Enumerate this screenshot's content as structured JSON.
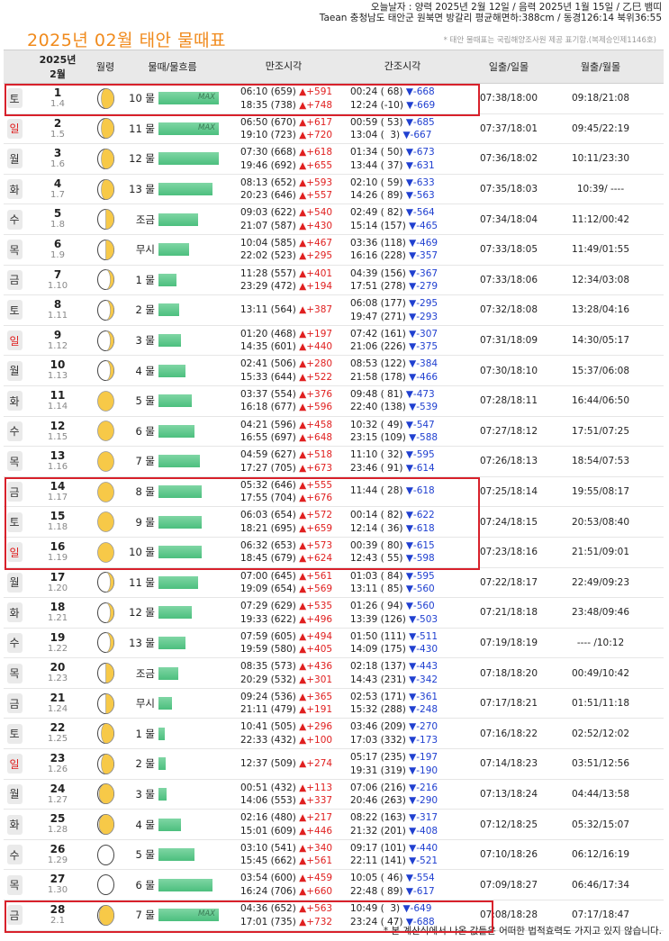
{
  "header": {
    "line1": "오늘날자 : 양력 2025년 2월 12일 / 음력 2025년 1월 15일 / 乙巳 뱀띠",
    "line2": "Taean 충청남도 태안군 원북면 방갈리 평균해면하:388cm / 동경126:14 북위36:55",
    "title": "2025년 02월 태안 물때표",
    "source": "* 태안 물때표는 국립해양조사원 제공 표기함.(복제승인제1146호)"
  },
  "columns": {
    "date_year": "2025년",
    "date_month": "2월",
    "moon": "월령",
    "tide": "물때/물흐름",
    "high": "만조시각",
    "low": "간조시각",
    "sun": "일출/일몰",
    "moonrise": "월출/월몰"
  },
  "colors": {
    "accent": "#f08a1c",
    "rise": "#e02020",
    "fall": "#2040d0",
    "bar": "#4cbf7e",
    "highlight": "#d8212b",
    "moon": "#f7c948"
  },
  "rows": [
    {
      "wd": "토",
      "sun": false,
      "d": "1",
      "l": "1.4",
      "moon": "crescent",
      "tide": "10 물",
      "bar": 1.0,
      "max": "MAX",
      "high": [
        "06:10 (659) ▲+591",
        "18:35 (738) ▲+748"
      ],
      "low": [
        "00:24 ( 68) ▼-668",
        "12:24 (-10) ▼-669"
      ],
      "ss": "07:38/18:00",
      "mr": "09:18/21:08"
    },
    {
      "wd": "일",
      "sun": true,
      "d": "2",
      "l": "1.5",
      "moon": "crescent",
      "tide": "11 물",
      "bar": 1.0,
      "max": "MAX",
      "high": [
        "06:50 (670) ▲+617",
        "19:10 (723) ▲+720"
      ],
      "low": [
        "00:59 ( 53) ▼-685",
        "13:04 (  3) ▼-667"
      ],
      "ss": "07:37/18:01",
      "mr": "09:45/22:19"
    },
    {
      "wd": "월",
      "sun": false,
      "d": "3",
      "l": "1.6",
      "moon": "crescent",
      "tide": "12 물",
      "bar": 1.0,
      "max": "",
      "high": [
        "07:30 (668) ▲+618",
        "19:46 (692) ▲+655"
      ],
      "low": [
        "01:34 ( 50) ▼-673",
        "13:44 ( 37) ▼-631"
      ],
      "ss": "07:36/18:02",
      "mr": "10:11/23:30"
    },
    {
      "wd": "화",
      "sun": false,
      "d": "4",
      "l": "1.7",
      "moon": "crescent",
      "tide": "13 물",
      "bar": 0.9,
      "max": "",
      "high": [
        "08:13 (652) ▲+593",
        "20:23 (646) ▲+557"
      ],
      "low": [
        "02:10 ( 59) ▼-633",
        "14:26 ( 89) ▼-563"
      ],
      "ss": "07:35/18:03",
      "mr": "10:39/ ----"
    },
    {
      "wd": "수",
      "sun": false,
      "d": "5",
      "l": "1.8",
      "moon": "half",
      "tide": "조금",
      "bar": 0.66,
      "max": "",
      "high": [
        "09:03 (622) ▲+540",
        "21:07 (587) ▲+430"
      ],
      "low": [
        "02:49 ( 82) ▼-564",
        "15:14 (157) ▼-465"
      ],
      "ss": "07:34/18:04",
      "mr": "11:12/00:42"
    },
    {
      "wd": "목",
      "sun": false,
      "d": "6",
      "l": "1.9",
      "moon": "half",
      "tide": "무시",
      "bar": 0.5,
      "max": "",
      "high": [
        "10:04 (585) ▲+467",
        "22:02 (523) ▲+295"
      ],
      "low": [
        "03:36 (118) ▼-469",
        "16:16 (228) ▼-357"
      ],
      "ss": "07:33/18:05",
      "mr": "11:49/01:55"
    },
    {
      "wd": "금",
      "sun": false,
      "d": "7",
      "l": "1.10",
      "moon": "gibbous",
      "tide": "1 물",
      "bar": 0.3,
      "max": "",
      "high": [
        "11:28 (557) ▲+401",
        "23:29 (472) ▲+194"
      ],
      "low": [
        "04:39 (156) ▼-367",
        "17:51 (278) ▼-279"
      ],
      "ss": "07:33/18:06",
      "mr": "12:34/03:08"
    },
    {
      "wd": "토",
      "sun": false,
      "d": "8",
      "l": "1.11",
      "moon": "gibbous",
      "tide": "2 물",
      "bar": 0.35,
      "max": "",
      "high": [
        "13:11 (564) ▲+387"
      ],
      "low": [
        "06:08 (177) ▼-295",
        "19:47 (271) ▼-293"
      ],
      "ss": "07:32/18:08",
      "mr": "13:28/04:16"
    },
    {
      "wd": "일",
      "sun": true,
      "d": "9",
      "l": "1.12",
      "moon": "gibbous",
      "tide": "3 물",
      "bar": 0.38,
      "max": "",
      "high": [
        "01:20 (468) ▲+197",
        "14:35 (601) ▲+440"
      ],
      "low": [
        "07:42 (161) ▼-307",
        "21:06 (226) ▼-375"
      ],
      "ss": "07:31/18:09",
      "mr": "14:30/05:17"
    },
    {
      "wd": "월",
      "sun": false,
      "d": "10",
      "l": "1.13",
      "moon": "gibbous",
      "tide": "4 물",
      "bar": 0.45,
      "max": "",
      "high": [
        "02:41 (506) ▲+280",
        "15:33 (644) ▲+522"
      ],
      "low": [
        "08:53 (122) ▼-384",
        "21:58 (178) ▼-466"
      ],
      "ss": "07:30/18:10",
      "mr": "15:37/06:08"
    },
    {
      "wd": "화",
      "sun": false,
      "d": "11",
      "l": "1.14",
      "moon": "full",
      "tide": "5 물",
      "bar": 0.55,
      "max": "",
      "high": [
        "03:37 (554) ▲+376",
        "16:18 (677) ▲+596"
      ],
      "low": [
        "09:48 ( 81) ▼-473",
        "22:40 (138) ▼-539"
      ],
      "ss": "07:28/18:11",
      "mr": "16:44/06:50"
    },
    {
      "wd": "수",
      "sun": false,
      "d": "12",
      "l": "1.15",
      "moon": "full",
      "tide": "6 물",
      "bar": 0.6,
      "max": "",
      "high": [
        "04:21 (596) ▲+458",
        "16:55 (697) ▲+648"
      ],
      "low": [
        "10:32 ( 49) ▼-547",
        "23:15 (109) ▼-588"
      ],
      "ss": "07:27/18:12",
      "mr": "17:51/07:25"
    },
    {
      "wd": "목",
      "sun": false,
      "d": "13",
      "l": "1.16",
      "moon": "full",
      "tide": "7 물",
      "bar": 0.68,
      "max": "",
      "high": [
        "04:59 (627) ▲+518",
        "17:27 (705) ▲+673"
      ],
      "low": [
        "11:10 ( 32) ▼-595",
        "23:46 ( 91) ▼-614"
      ],
      "ss": "07:26/18:13",
      "mr": "18:54/07:53"
    },
    {
      "wd": "금",
      "sun": false,
      "d": "14",
      "l": "1.17",
      "moon": "full",
      "tide": "8 물",
      "bar": 0.72,
      "max": "",
      "high": [
        "05:32 (646) ▲+555",
        "17:55 (704) ▲+676"
      ],
      "low": [
        "11:44 ( 28) ▼-618"
      ],
      "ss": "07:25/18:14",
      "mr": "19:55/08:17"
    },
    {
      "wd": "토",
      "sun": false,
      "d": "15",
      "l": "1.18",
      "moon": "full",
      "tide": "9 물",
      "bar": 0.72,
      "max": "",
      "high": [
        "06:03 (654) ▲+572",
        "18:21 (695) ▲+659"
      ],
      "low": [
        "00:14 ( 82) ▼-622",
        "12:14 ( 36) ▼-618"
      ],
      "ss": "07:24/18:15",
      "mr": "20:53/08:40"
    },
    {
      "wd": "일",
      "sun": true,
      "d": "16",
      "l": "1.19",
      "moon": "full",
      "tide": "10 물",
      "bar": 0.72,
      "max": "",
      "high": [
        "06:32 (653) ▲+573",
        "18:45 (679) ▲+624"
      ],
      "low": [
        "00:39 ( 80) ▼-615",
        "12:43 ( 55) ▼-598"
      ],
      "ss": "07:23/18:16",
      "mr": "21:51/09:01"
    },
    {
      "wd": "월",
      "sun": false,
      "d": "17",
      "l": "1.20",
      "moon": "gibbous",
      "tide": "11 물",
      "bar": 0.65,
      "max": "",
      "high": [
        "07:00 (645) ▲+561",
        "19:09 (654) ▲+569"
      ],
      "low": [
        "01:03 ( 84) ▼-595",
        "13:11 ( 85) ▼-560"
      ],
      "ss": "07:22/18:17",
      "mr": "22:49/09:23"
    },
    {
      "wd": "화",
      "sun": false,
      "d": "18",
      "l": "1.21",
      "moon": "gibbous",
      "tide": "12 물",
      "bar": 0.55,
      "max": "",
      "high": [
        "07:29 (629) ▲+535",
        "19:33 (622) ▲+496"
      ],
      "low": [
        "01:26 ( 94) ▼-560",
        "13:39 (126) ▼-503"
      ],
      "ss": "07:21/18:18",
      "mr": "23:48/09:46"
    },
    {
      "wd": "수",
      "sun": false,
      "d": "19",
      "l": "1.22",
      "moon": "gibbous",
      "tide": "13 물",
      "bar": 0.45,
      "max": "",
      "high": [
        "07:59 (605) ▲+494",
        "19:59 (580) ▲+405"
      ],
      "low": [
        "01:50 (111) ▼-511",
        "14:09 (175) ▼-430"
      ],
      "ss": "07:19/18:19",
      "mr": "---- /10:12"
    },
    {
      "wd": "목",
      "sun": false,
      "d": "20",
      "l": "1.23",
      "moon": "half",
      "tide": "조금",
      "bar": 0.33,
      "max": "",
      "high": [
        "08:35 (573) ▲+436",
        "20:29 (532) ▲+301"
      ],
      "low": [
        "02:18 (137) ▼-443",
        "14:43 (231) ▼-342"
      ],
      "ss": "07:18/18:20",
      "mr": "00:49/10:42"
    },
    {
      "wd": "금",
      "sun": false,
      "d": "21",
      "l": "1.24",
      "moon": "half",
      "tide": "무시",
      "bar": 0.22,
      "max": "",
      "high": [
        "09:24 (536) ▲+365",
        "21:11 (479) ▲+191"
      ],
      "low": [
        "02:53 (171) ▼-361",
        "15:32 (288) ▼-248"
      ],
      "ss": "07:17/18:21",
      "mr": "01:51/11:18"
    },
    {
      "wd": "토",
      "sun": false,
      "d": "22",
      "l": "1.25",
      "moon": "crescent",
      "tide": "1 물",
      "bar": 0.1,
      "max": "",
      "high": [
        "10:41 (505) ▲+296",
        "22:33 (432) ▲+100"
      ],
      "low": [
        "03:46 (209) ▼-270",
        "17:03 (332) ▼-173"
      ],
      "ss": "07:16/18:22",
      "mr": "02:52/12:02"
    },
    {
      "wd": "일",
      "sun": true,
      "d": "23",
      "l": "1.26",
      "moon": "crescent",
      "tide": "2 물",
      "bar": 0.12,
      "max": "",
      "high": [
        "12:37 (509) ▲+274"
      ],
      "low": [
        "05:17 (235) ▼-197",
        "19:31 (319) ▼-190"
      ],
      "ss": "07:14/18:23",
      "mr": "03:51/12:56"
    },
    {
      "wd": "월",
      "sun": false,
      "d": "24",
      "l": "1.27",
      "moon": "thin",
      "tide": "3 물",
      "bar": 0.13,
      "max": "",
      "high": [
        "00:51 (432) ▲+113",
        "14:06 (553) ▲+337"
      ],
      "low": [
        "07:06 (216) ▼-216",
        "20:46 (263) ▼-290"
      ],
      "ss": "07:13/18:24",
      "mr": "04:44/13:58"
    },
    {
      "wd": "화",
      "sun": false,
      "d": "25",
      "l": "1.28",
      "moon": "thin",
      "tide": "4 물",
      "bar": 0.38,
      "max": "",
      "high": [
        "02:16 (480) ▲+217",
        "15:01 (609) ▲+446"
      ],
      "low": [
        "08:22 (163) ▼-317",
        "21:32 (201) ▼-408"
      ],
      "ss": "07:12/18:25",
      "mr": "05:32/15:07"
    },
    {
      "wd": "수",
      "sun": false,
      "d": "26",
      "l": "1.29",
      "moon": "new",
      "tide": "5 물",
      "bar": 0.6,
      "max": "",
      "high": [
        "03:10 (541) ▲+340",
        "15:45 (662) ▲+561"
      ],
      "low": [
        "09:17 (101) ▼-440",
        "22:11 (141) ▼-521"
      ],
      "ss": "07:10/18:26",
      "mr": "06:12/16:19"
    },
    {
      "wd": "목",
      "sun": false,
      "d": "27",
      "l": "1.30",
      "moon": "new",
      "tide": "6 물",
      "bar": 0.9,
      "max": "",
      "high": [
        "03:54 (600) ▲+459",
        "16:24 (706) ▲+660"
      ],
      "low": [
        "10:05 ( 46) ▼-554",
        "22:48 ( 89) ▼-617"
      ],
      "ss": "07:09/18:27",
      "mr": "06:46/17:34"
    },
    {
      "wd": "금",
      "sun": false,
      "d": "28",
      "l": "2.1",
      "moon": "thin",
      "tide": "7 물",
      "bar": 1.0,
      "max": "MAX",
      "high": [
        "04:36 (652) ▲+563",
        "17:01 (735) ▲+732"
      ],
      "low": [
        "10:49 (  3) ▼-649",
        "23:24 ( 47) ▼-688"
      ],
      "ss": "07:08/18:28",
      "mr": "07:17/18:47"
    }
  ],
  "footer": "* 본 계산식에서 나온 값들은 어떠한 법적효력도 가지고 있지 않습니다."
}
